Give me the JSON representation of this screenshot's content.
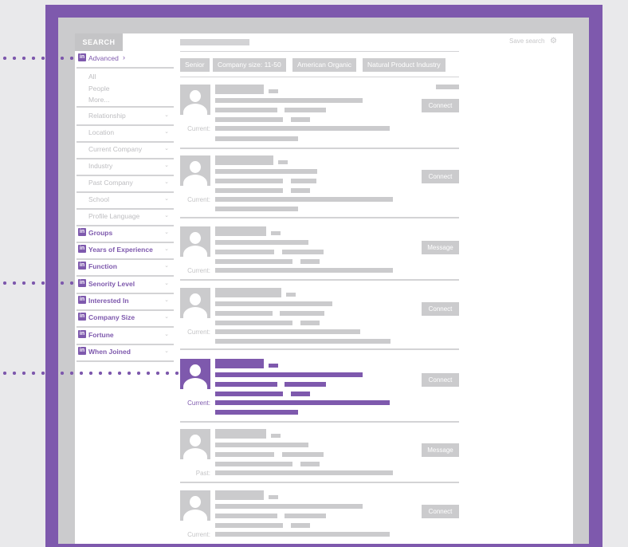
{
  "search_tab": "SEARCH",
  "save_search": "Save search",
  "filters": [
    "Senior",
    "Company size: 11-50",
    "American Organic",
    "Natural Product Industry"
  ],
  "sidebar": {
    "advanced": "Advanced",
    "sub_items": [
      "All",
      "People",
      "More..."
    ],
    "plain_filters": [
      "Relationship",
      "Location",
      "Current Company",
      "Industry",
      "Past Company",
      "School",
      "Profile Language"
    ],
    "linkedin_filters": [
      "Groups",
      "Years of Experience",
      "Function",
      "Senority Level",
      "Interested In",
      "Company Size",
      "Fortune",
      "When Joined"
    ]
  },
  "li_badge": "in",
  "results": [
    {
      "label": "Current:",
      "action": "Connect"
    },
    {
      "label": "Current:",
      "action": "Connect"
    },
    {
      "label": "Current:",
      "action": "Message"
    },
    {
      "label": "Current:",
      "action": "Connect"
    },
    {
      "label": "Current:",
      "action": "Connect"
    },
    {
      "label": "Past:",
      "action": "Message"
    },
    {
      "label": "Current:",
      "action": "Connect"
    }
  ],
  "colors": {
    "accent": "#7e59ad",
    "placeholder": "#cbcbcd"
  }
}
